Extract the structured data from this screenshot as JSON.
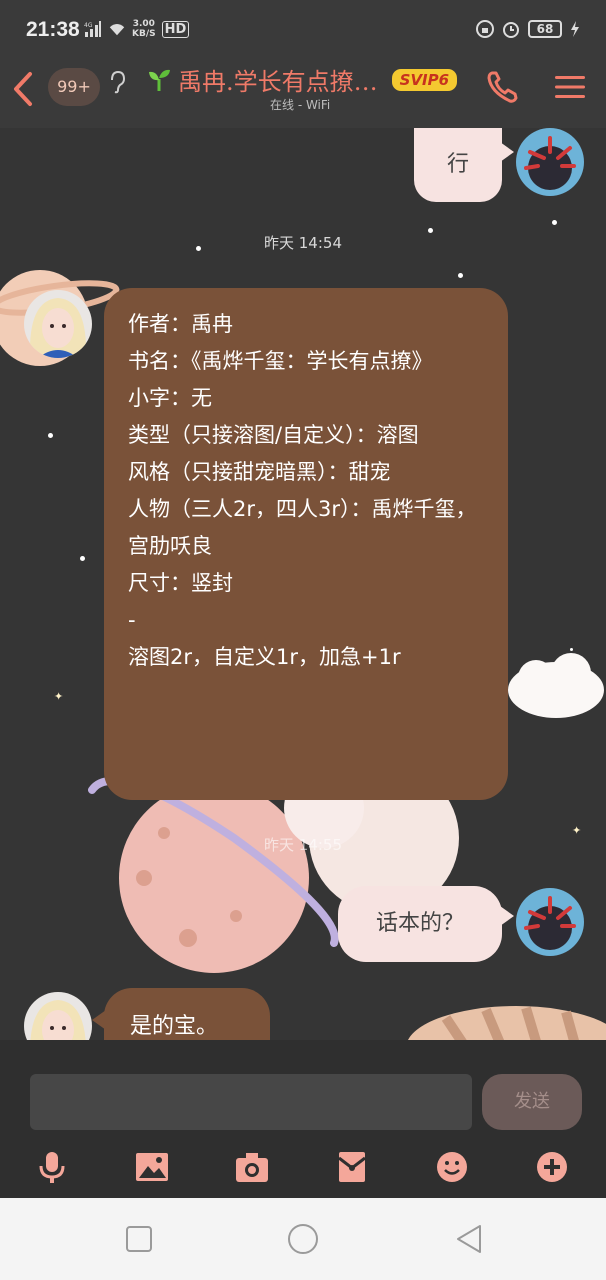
{
  "status": {
    "time": "21:38",
    "network": "4G",
    "speed_value": "3.00",
    "speed_unit": "KB/S",
    "hd": "HD",
    "battery": "68"
  },
  "header": {
    "unread": "99+",
    "title": "禹冉.学长有点撩…",
    "svip": "SVIP6",
    "subtitle": "在线 - WiFi"
  },
  "messages": {
    "ok_text": "行",
    "timestamp1": "昨天 14:54",
    "info_text": "作者：禹冉\n书名：《禹烨千玺：学长有点撩》\n小字：无\n类型（只接溶图/自定义）：溶图\n风格（只接甜宠暗黑）：甜宠\n人物（三人2r，四人3r）：禹烨千玺，宫肋㕭良\n尺寸：竖封\n-\n溶图2r，自定义1r，加急+1r",
    "timestamp2": "昨天 14:55",
    "question_text": "话本的？",
    "yes_text": "是的宝。"
  },
  "input": {
    "value": "",
    "send_label": "发送"
  },
  "colors": {
    "accent": "#f07a68",
    "bubble_incoming": "#7a5239",
    "bubble_outgoing": "#f7e3e1",
    "svip": "#f4c930"
  },
  "icons": {
    "toolbar": [
      "mic-icon",
      "image-icon",
      "camera-icon",
      "red-packet-icon",
      "emoji-icon",
      "plus-icon"
    ],
    "nav": [
      "square-recent-icon",
      "circle-home-icon",
      "triangle-back-icon"
    ]
  }
}
